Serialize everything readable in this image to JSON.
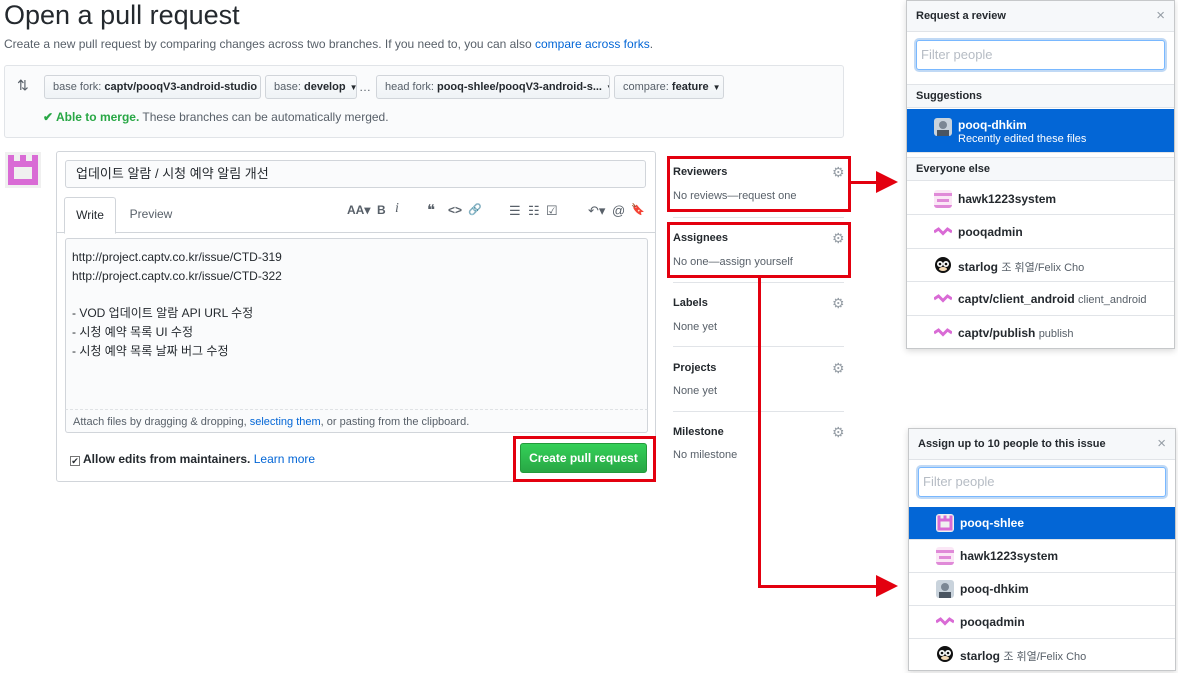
{
  "header": {
    "title": "Open a pull request",
    "subtitle_text": "Create a new pull request by comparing changes across two branches. If you need to, you can also ",
    "subtitle_link": "compare across forks",
    "subtitle_end": "."
  },
  "range": {
    "base_fork_label": "base fork:",
    "base_fork_value": "captv/pooqV3-android-studio",
    "base_label": "base:",
    "base_value": "develop",
    "dots": "…",
    "head_fork_label": "head fork:",
    "head_fork_value": "pooq-shlee/pooqV3-android-s...",
    "compare_label": "compare:",
    "compare_value": "feature",
    "merge_status": "✔ Able to merge.",
    "merge_text": " These branches can be automatically merged."
  },
  "form": {
    "title_value": "업데이트 알람 / 시청 예약 알림 개선",
    "tab_write": "Write",
    "tab_preview": "Preview",
    "toolbar": [
      "AA▾",
      "B",
      "i",
      "❝",
      "<>",
      "🔗",
      "☰",
      "☷",
      "☑",
      "↶▾",
      "@",
      "🔖"
    ],
    "body_value": "http://project.captv.co.kr/issue/CTD-319\nhttp://project.captv.co.kr/issue/CTD-322\n\n- VOD 업데이트 알람 API URL 수정\n- 시청 예약 목록 UI 수정\n- 시청 예약 목록 날짜 버그 수정",
    "attach_a": "Attach files by dragging & dropping, ",
    "attach_link": "selecting them",
    "attach_b": ", or pasting from the clipboard.",
    "allow_edits": "Allow edits from maintainers.",
    "learn_more": "Learn more",
    "create_button": "Create pull request"
  },
  "sidebar": {
    "reviewers": {
      "label": "Reviewers",
      "value": "No reviews—request one"
    },
    "assignees": {
      "label": "Assignees",
      "value": "No one—assign yourself"
    },
    "labels": {
      "label": "Labels",
      "value": "None yet"
    },
    "projects": {
      "label": "Projects",
      "value": "None yet"
    },
    "milestone": {
      "label": "Milestone",
      "value": "No milestone"
    }
  },
  "review_popover": {
    "title": "Request a review",
    "close": "×",
    "filter_placeholder": "Filter people",
    "suggestions_label": "Suggestions",
    "suggestion": {
      "name": "pooq-dhkim",
      "sub": "Recently edited these files"
    },
    "everyone_label": "Everyone else",
    "people": [
      {
        "name": "hawk1223system",
        "sub": ""
      },
      {
        "name": "pooqadmin",
        "sub": ""
      },
      {
        "name": "starlog",
        "sub": "조 휘열/Felix Cho"
      },
      {
        "name": "captv/client_android",
        "sub": "client_android"
      },
      {
        "name": "captv/publish",
        "sub": "publish"
      }
    ]
  },
  "assign_popover": {
    "title": "Assign up to 10 people to this issue",
    "close": "×",
    "filter_placeholder": "Filter people",
    "people": [
      {
        "name": "pooq-shlee",
        "sub": ""
      },
      {
        "name": "hawk1223system",
        "sub": ""
      },
      {
        "name": "pooq-dhkim",
        "sub": ""
      },
      {
        "name": "pooqadmin",
        "sub": ""
      },
      {
        "name": "starlog",
        "sub": "조 휘열/Felix Cho"
      }
    ]
  },
  "colors": {
    "accent": "#0366d6",
    "green": "#28a745",
    "highlight": "#e3000f"
  }
}
